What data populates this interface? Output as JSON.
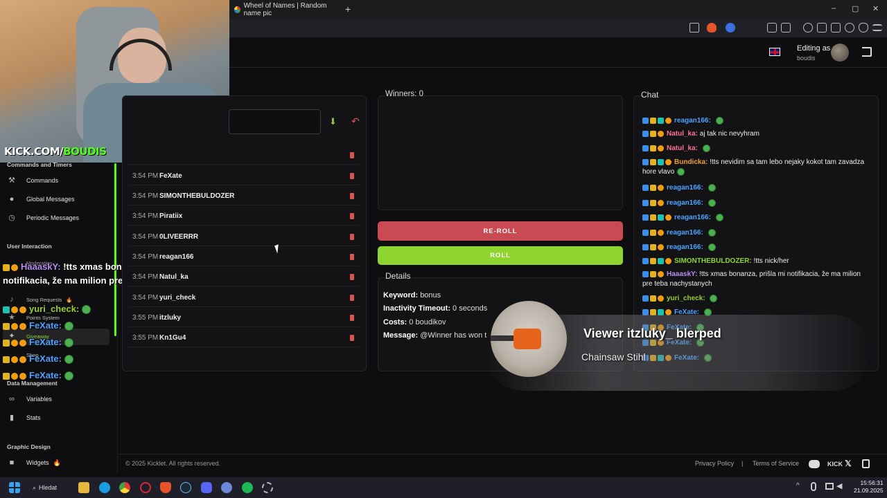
{
  "browser": {
    "tab_title": "Wheel of Names | Random name pic",
    "new_tab": "+",
    "minimize": "–",
    "maximize": "▢",
    "close": "✕"
  },
  "header": {
    "editing_as": "Editing as",
    "user": "boudis"
  },
  "webcam": {
    "watermark_prefix": "KICK.COM/",
    "watermark_channel": "BOUDIS"
  },
  "sidebar": {
    "commands_heading": "Commands and Timers",
    "commands": [
      "Commands",
      "Global Messages",
      "Periodic Messages"
    ],
    "user_interaction_heading": "User Interaction",
    "user_interaction": [
      "Moderation",
      "Song Requests",
      "Points System",
      "Giveaway",
      "Shop"
    ],
    "data_heading": "Data Management",
    "data": [
      "Variables",
      "Stats"
    ],
    "graphic_heading": "Graphic Design",
    "graphic": [
      "Widgets"
    ],
    "fire_icon": "🔥"
  },
  "chat_overlay": [
    {
      "user": "HaaaskY:",
      "text": "!tts xmas bonanza, prišla mi notifikacia, že ma milion pre teba nachystanych",
      "color": "#b98cf0"
    },
    {
      "user": "yuri_check:",
      "text": "",
      "color": "#9acd32"
    },
    {
      "user": "FeXate:",
      "text": "",
      "color": "#4da3ff"
    },
    {
      "user": "FeXate:",
      "text": "",
      "color": "#4da3ff"
    },
    {
      "user": "FeXate:",
      "text": "",
      "color": "#4da3ff"
    },
    {
      "user": "FeXate:",
      "text": "",
      "color": "#4da3ff"
    }
  ],
  "entries": [
    {
      "time": "3:54 PM",
      "name": "FeXate"
    },
    {
      "time": "3:54 PM",
      "name": "SIMONTHEBULDOZER"
    },
    {
      "time": "3:54 PM",
      "name": "Piratiix"
    },
    {
      "time": "3:54 PM",
      "name": "0LIVEERRR"
    },
    {
      "time": "3:54 PM",
      "name": "reagan166"
    },
    {
      "time": "3:54 PM",
      "name": "Natul_ka"
    },
    {
      "time": "3:54 PM",
      "name": "yuri_check"
    },
    {
      "time": "3:55 PM",
      "name": "itzluky"
    },
    {
      "time": "3:55 PM",
      "name": "Kn1Gu4"
    }
  ],
  "winners": {
    "label": "Winners: 0"
  },
  "buttons": {
    "reroll": "RE-ROLL",
    "roll": "ROLL"
  },
  "details": {
    "title": "Details",
    "keyword_label": "Keyword:",
    "keyword": "bonus",
    "timeout_label": "Inactivity Timeout:",
    "timeout": "0 seconds",
    "costs_label": "Costs:",
    "costs": "0 boudikov",
    "message_label": "Message:",
    "message": "@Winner has won t"
  },
  "chat": {
    "title": "Chat",
    "messages": [
      {
        "user": "reagan166:",
        "text": "",
        "color": "#4da3ff",
        "emote": true
      },
      {
        "user": "Natul_ka:",
        "text": "aj tak nic nevyhram",
        "color": "#ff6f91",
        "emote": false
      },
      {
        "user": "Natul_ka:",
        "text": "",
        "color": "#ff6f91",
        "emote": true
      },
      {
        "user": "Bundicka:",
        "text": "!tts nevidim sa tam lebo nejaky kokot tam zavadza hore vlavo",
        "color": "#f0a030",
        "emote": true
      },
      {
        "user": "reagan166:",
        "text": "",
        "color": "#4da3ff",
        "emote": true
      },
      {
        "user": "reagan166:",
        "text": "",
        "color": "#4da3ff",
        "emote": true
      },
      {
        "user": "reagan166:",
        "text": "",
        "color": "#4da3ff",
        "emote": true
      },
      {
        "user": "reagan166:",
        "text": "",
        "color": "#4da3ff",
        "emote": true
      },
      {
        "user": "reagan166:",
        "text": "",
        "color": "#4da3ff",
        "emote": true
      },
      {
        "user": "SIMONTHEBULDOZER:",
        "text": "!tts nick/her",
        "color": "#8ed62f",
        "emote": false
      },
      {
        "user": "HaaaskY:",
        "text": "!tts xmas bonanza, prišla mi notifikacia, že ma milion pre teba nachystanych",
        "color": "#b98cf0",
        "emote": false
      },
      {
        "user": "yuri_check:",
        "text": "",
        "color": "#9acd32",
        "emote": true
      },
      {
        "user": "FeXate:",
        "text": "",
        "color": "#4da3ff",
        "emote": true
      },
      {
        "user": "FeXate:",
        "text": "",
        "color": "#4da3ff",
        "emote": true
      },
      {
        "user": "FeXate:",
        "text": "",
        "color": "#4da3ff",
        "emote": true
      },
      {
        "user": "FeXate:",
        "text": "",
        "color": "#4da3ff",
        "emote": true
      }
    ]
  },
  "alert": {
    "title": "Viewer itzluky_ blerped",
    "subtitle": "Chainsaw Stihl"
  },
  "footer": {
    "copyright": "© 2025 Kicklet. All rights reserved.",
    "privacy": "Privacy Policy",
    "separator": "|",
    "terms": "Terms of Service",
    "kick": "KICK",
    "x": "𝕏"
  },
  "taskbar": {
    "search": "Hledat",
    "time": "15:56:31",
    "date": "21.09.2025"
  }
}
